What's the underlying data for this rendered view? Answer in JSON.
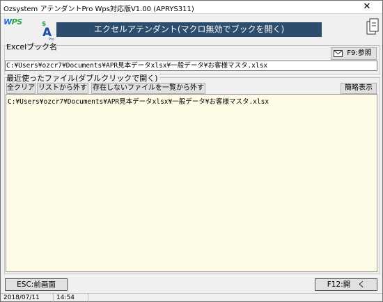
{
  "window": {
    "title": "Ozsystem アテンダントPro Wps対応版V1.00 (APRYS311)",
    "close_glyph": "✕"
  },
  "header": {
    "wps_logo_w": "W",
    "wps_logo_ps": "PS",
    "banner": "エクセルアテンダント(マクロ無効でブックを開く)"
  },
  "book_section": {
    "label": "Excelブック名",
    "browse_button": "F9:参照",
    "path_value": "C:¥Users¥ozcr7¥Documents¥APR見本データxlsx¥一般データ¥お客様マスタ.xlsx"
  },
  "recent_section": {
    "label": "最近使ったファイル(ダブルクリックで開く)",
    "buttons": {
      "clear_all": "全クリア",
      "remove_from_list": "リストから外す",
      "remove_missing": "存在しないファイルを一覧から外す",
      "brief_view": "簡略表示"
    },
    "files": [
      "C:¥Users¥ozcr7¥Documents¥APR見本データxlsx¥一般データ¥お客様マスタ.xlsx"
    ]
  },
  "footer": {
    "back_button": "ESC:前画面",
    "open_button": "F12:開　く"
  },
  "status": {
    "date": "2018/07/11",
    "time": "14:54"
  },
  "colors": {
    "banner_bg": "#2d4d6e",
    "list_bg": "#fefbe6"
  }
}
